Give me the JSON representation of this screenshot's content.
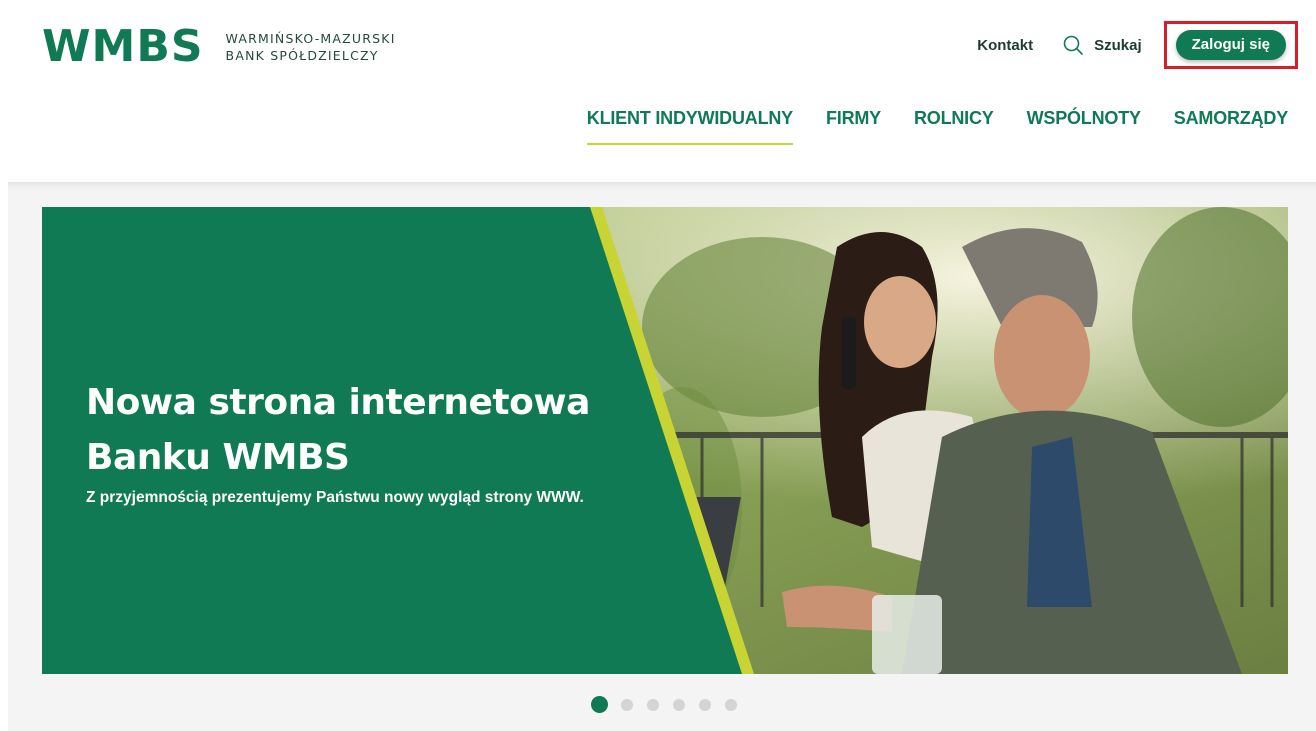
{
  "brand": {
    "logo_mark": "WMBS",
    "name_line1": "WARMIŃSKO-MAZURSKI",
    "name_line2": "BANK SPÓŁDZIELCZY"
  },
  "top_links": {
    "contact": "Kontakt",
    "search": "Szukaj",
    "login": "Zaloguj się"
  },
  "main_nav": [
    {
      "label": "KLIENT INDYWIDUALNY",
      "active": true
    },
    {
      "label": "FIRMY"
    },
    {
      "label": "ROLNICY"
    },
    {
      "label": "WSPÓLNOTY"
    },
    {
      "label": "SAMORZĄDY"
    }
  ],
  "hero": {
    "title_line1": "Nowa strona internetowa",
    "title_line2": "Banku WMBS",
    "subtitle": "Z przyjemnością prezentujemy Państwu nowy wygląd strony WWW."
  },
  "slider": {
    "total": 6,
    "active_index": 0
  },
  "colors": {
    "brand_green": "#0f7a53",
    "accent_lime": "#c8d434",
    "highlight_red": "#d3202a"
  },
  "icons": {
    "search": "magnifier-icon"
  }
}
